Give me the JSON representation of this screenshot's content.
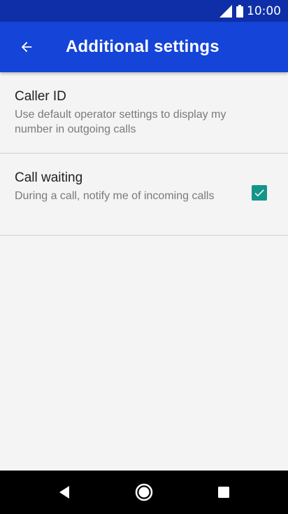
{
  "status_bar": {
    "time": "10:00"
  },
  "header": {
    "title": "Additional settings"
  },
  "settings": [
    {
      "title": "Caller ID",
      "description": "Use default operator settings to display my number in outgoing calls"
    },
    {
      "title": "Call waiting",
      "description": "During a call, notify me of incoming calls",
      "checked": true
    }
  ],
  "colors": {
    "status_bar": "#0f2fa8",
    "app_bar": "#1444d8",
    "checkbox": "#14958a",
    "background": "#f4f4f4"
  },
  "icons": {
    "back": "arrow-left-icon",
    "signal": "signal-icon",
    "battery": "battery-icon",
    "nav_back": "triangle-back-icon",
    "nav_home": "circle-home-icon",
    "nav_recent": "square-recents-icon"
  }
}
